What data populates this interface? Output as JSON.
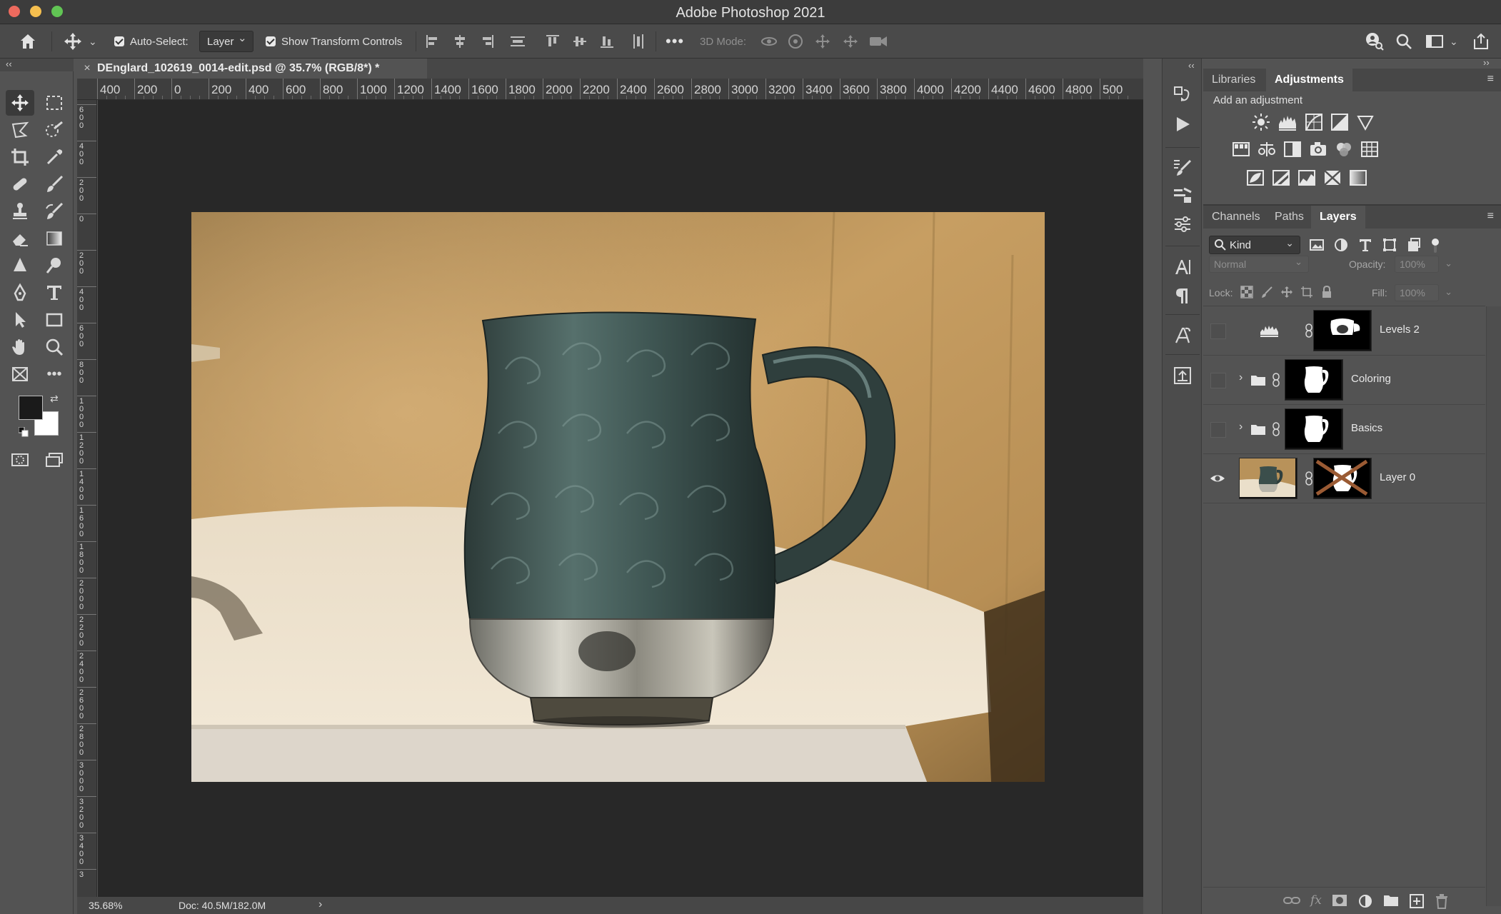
{
  "app": {
    "title": "Adobe Photoshop 2021"
  },
  "options_bar": {
    "auto_select_label": "Auto-Select:",
    "auto_select_checked": true,
    "auto_select_value": "Layer",
    "show_transform_label": "Show Transform Controls",
    "show_transform_checked": true,
    "mode_3d_label": "3D Mode:"
  },
  "document": {
    "tab_title": "DEnglard_102619_0014-edit.psd @ 35.7% (RGB/8*) *",
    "zoom": "35.68%",
    "doc_size": "Doc: 40.5M/182.0M",
    "h_ruler_labels": [
      "400",
      "200",
      "0",
      "200",
      "400",
      "600",
      "800",
      "1000",
      "1200",
      "1400",
      "1600",
      "1800",
      "2000",
      "2200",
      "2400",
      "2600",
      "2800",
      "3000",
      "3200",
      "3400",
      "3600",
      "3800",
      "4000",
      "4200",
      "4400",
      "4600",
      "4800",
      "500"
    ],
    "v_ruler_labels": [
      "600",
      "400",
      "200",
      "0",
      "200",
      "400",
      "600",
      "800",
      "1000",
      "1200",
      "1400",
      "1600",
      "1800",
      "2000",
      "2200",
      "2400",
      "2600",
      "2800",
      "3000",
      "3200",
      "3400",
      "3"
    ]
  },
  "tools": [
    "move-tool",
    "marquee-tool",
    "lasso-tool",
    "quick-selection-tool",
    "crop-tool",
    "eyedropper-tool",
    "healing-brush-tool",
    "brush-tool",
    "clone-stamp-tool",
    "history-brush-tool",
    "eraser-tool",
    "gradient-tool",
    "blur-tool",
    "dodge-tool",
    "pen-tool",
    "type-tool",
    "path-selection-tool",
    "rectangle-tool",
    "hand-tool",
    "zoom-tool",
    "frame-tool",
    "more-tools"
  ],
  "adjustments_panel": {
    "tabs": [
      "Libraries",
      "Adjustments"
    ],
    "active_tab": "Adjustments",
    "hint": "Add an adjustment"
  },
  "layers_panel": {
    "tabs": [
      "Channels",
      "Paths",
      "Layers"
    ],
    "active_tab": "Layers",
    "filter_kind": "Kind",
    "blend_mode": "Normal",
    "opacity_label": "Opacity:",
    "opacity_value": "100%",
    "lock_label": "Lock:",
    "fill_label": "Fill:",
    "fill_value": "100%",
    "layers": [
      {
        "name": "Levels 2",
        "type": "adjustment",
        "visible": false
      },
      {
        "name": "Coloring",
        "type": "group",
        "visible": false
      },
      {
        "name": "Basics",
        "type": "group",
        "visible": false
      },
      {
        "name": "Layer 0",
        "type": "pixel",
        "visible": true
      }
    ]
  },
  "colors": {
    "foreground": "#1a1a1a",
    "background": "#ffffff",
    "workspace": "#282828",
    "panel": "#535353"
  }
}
